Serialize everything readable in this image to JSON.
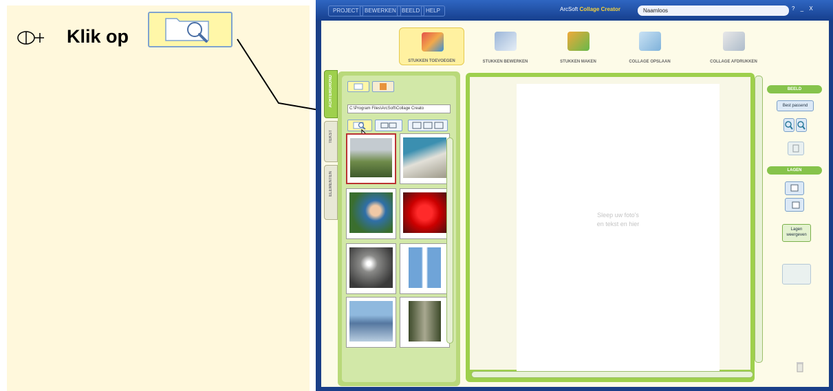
{
  "instruction": {
    "text": "Klik op",
    "icons": [
      "mouse-icon",
      "zoom-folder-icon"
    ]
  },
  "app": {
    "menu": [
      "PROJECT",
      "BEWERKEN",
      "BEELD",
      "HELP"
    ],
    "title_prefix": "ArcSoft",
    "title_brand": "Collage Creator",
    "document_name": "Naamloos",
    "window_controls": "? _ X",
    "modes": [
      {
        "label": "STUKKEN TOEVOEGEN",
        "icon": "add-pieces-icon",
        "active": true
      },
      {
        "label": "STUKKEN BEWERKEN",
        "icon": "edit-pieces-icon",
        "active": false
      },
      {
        "label": "STUKKEN MAKEN",
        "icon": "make-pieces-icon",
        "active": false
      },
      {
        "label": "COLLAGE OPSLAAN",
        "icon": "save-collage-icon",
        "active": false
      },
      {
        "label": "COLLAGE AFDRUKKEN",
        "icon": "print-collage-icon",
        "active": false
      }
    ],
    "side_tabs": [
      "ACHTERGROND",
      "TEKST",
      "ELEMENTEN"
    ],
    "path": "C:\\Program Files\\ArcSoft\\Collage Creato",
    "canvas_hint": [
      "Sleep uw foto's",
      "en tekst en hier"
    ],
    "right_panel": {
      "section_view": "BEELD",
      "best_fit": "Best passend",
      "section_layers": "LAGEN",
      "layer_button": "Lagen weergeven"
    }
  }
}
